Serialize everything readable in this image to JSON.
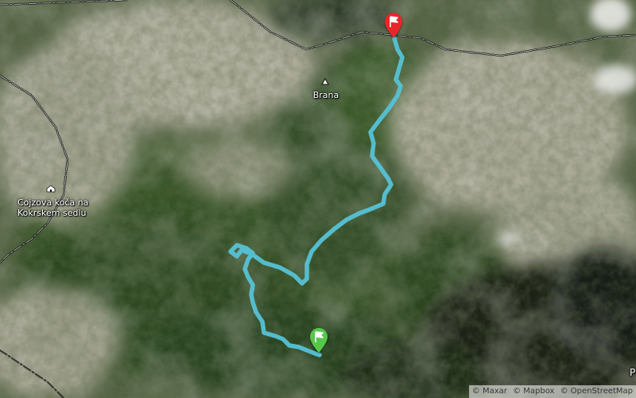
{
  "map": {
    "style": "satellite",
    "route_color": "#55c2d6",
    "start_marker_color": "#55c84a",
    "end_marker_color": "#e8262a",
    "border_color": "#222222"
  },
  "places": {
    "summit": "Brana",
    "hut_line1": "Cojzova koča na",
    "hut_line2": "Kokrskem sedlu"
  },
  "partial_label": "P",
  "attribution": [
    "© Maxar",
    "© Mapbox",
    "© OpenStreetMap"
  ]
}
